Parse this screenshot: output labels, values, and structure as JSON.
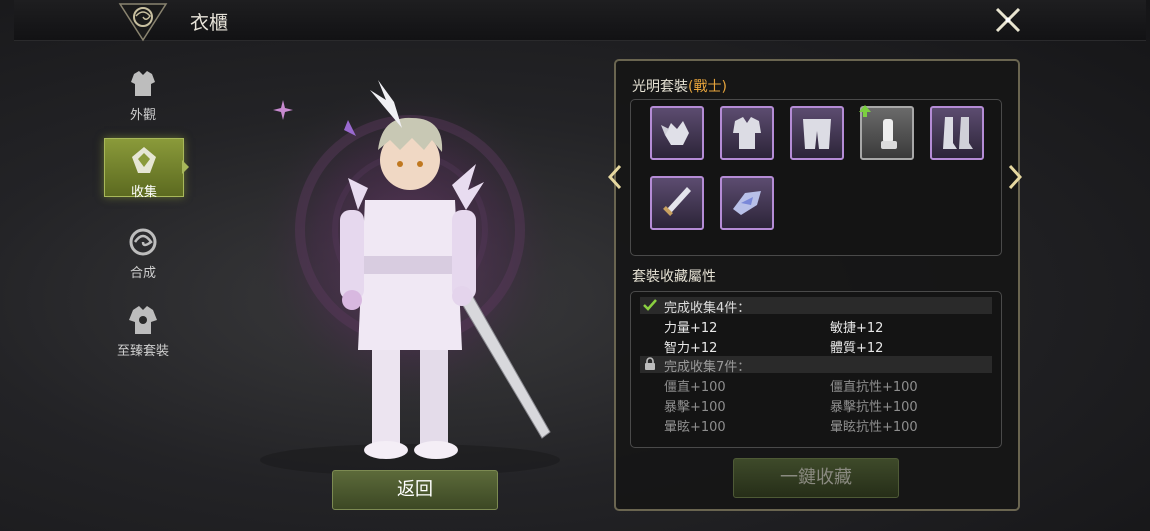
{
  "header": {
    "title": "衣櫃"
  },
  "sidebar": {
    "items": [
      {
        "label": "外觀"
      },
      {
        "label": "收集"
      },
      {
        "label": "合成"
      },
      {
        "label": "至臻套裝"
      }
    ]
  },
  "back_label": "返回",
  "set": {
    "name": "光明套裝",
    "class": "(戰士)"
  },
  "attr_title": "套裝收藏屬性",
  "tiers": [
    {
      "label": "完成收集4件：",
      "stats": [
        "力量+12",
        "敏捷+12",
        "智力+12",
        "體質+12"
      ]
    },
    {
      "label": "完成收集7件：",
      "stats": [
        "僵直+100",
        "僵直抗性+100",
        "暴擊+100",
        "暴擊抗性+100",
        "暈眩+100",
        "暈眩抗性+100"
      ]
    }
  ],
  "collect_label": "一鍵收藏",
  "colors": {
    "accent": "#a8b85a",
    "set_class": "#e6a43c",
    "item_border": "#b58cd6"
  }
}
